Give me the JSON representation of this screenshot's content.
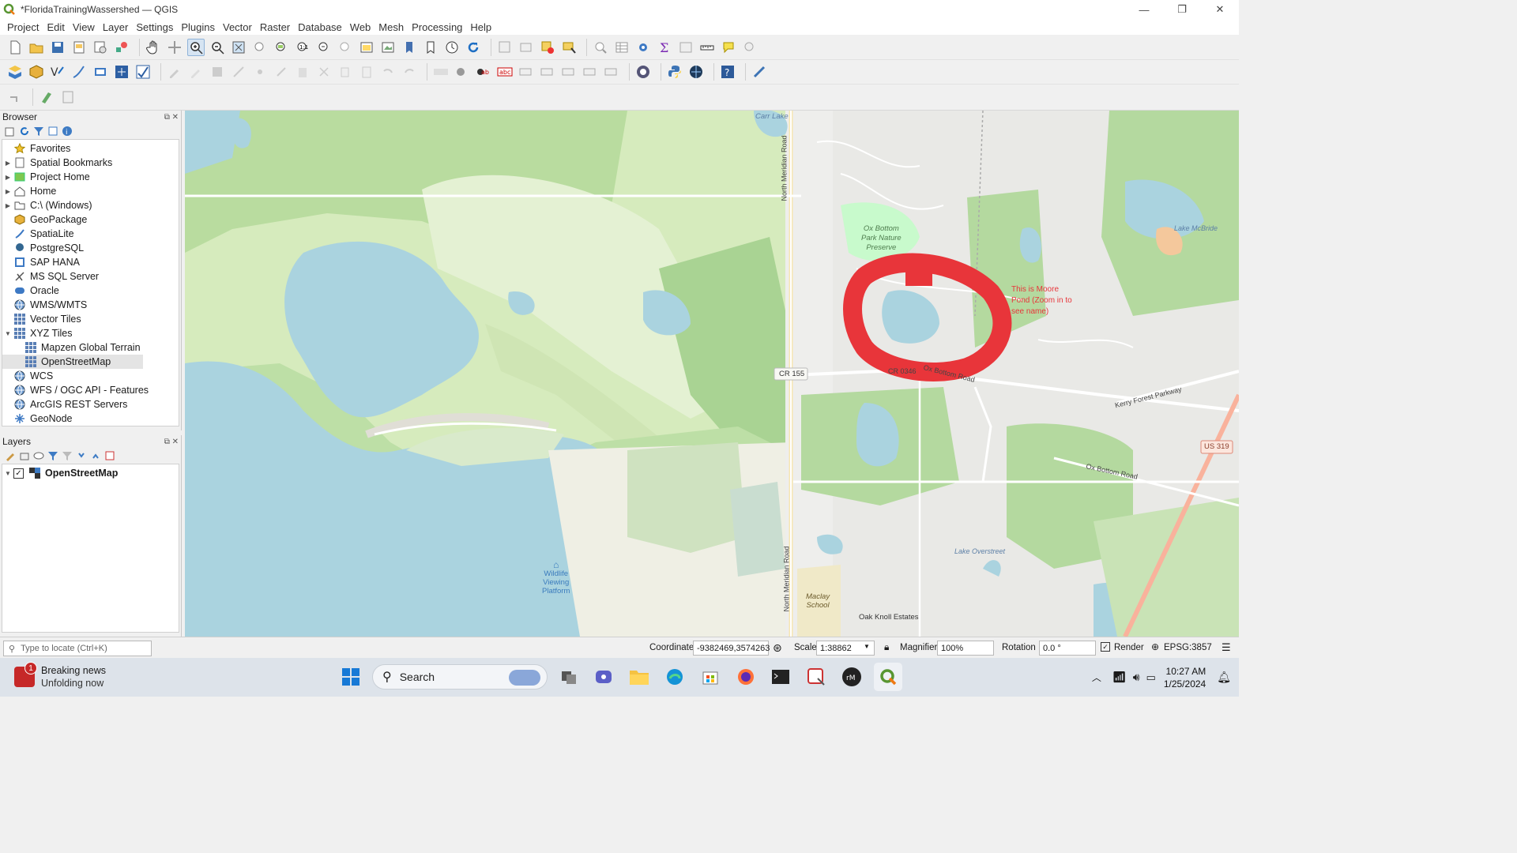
{
  "window": {
    "title": "*FloridaTrainingWassershed — QGIS",
    "controls": {
      "minimize": "—",
      "maximize": "❐",
      "close": "✕"
    }
  },
  "menu": [
    "Project",
    "Edit",
    "View",
    "Layer",
    "Settings",
    "Plugins",
    "Vector",
    "Raster",
    "Database",
    "Web",
    "Mesh",
    "Processing",
    "Help"
  ],
  "browser": {
    "title": "Browser",
    "items": [
      {
        "label": "Favorites",
        "icon": "star-icon",
        "expander": ""
      },
      {
        "label": "Spatial Bookmarks",
        "icon": "bookmark-icon",
        "expander": "▶"
      },
      {
        "label": "Project Home",
        "icon": "project-home-icon",
        "expander": "▶"
      },
      {
        "label": "Home",
        "icon": "home-icon",
        "expander": "▶"
      },
      {
        "label": "C:\\ (Windows)",
        "icon": "folder-icon",
        "expander": "▶"
      },
      {
        "label": "GeoPackage",
        "icon": "geopackage-icon",
        "expander": ""
      },
      {
        "label": "SpatiaLite",
        "icon": "spatialite-icon",
        "expander": ""
      },
      {
        "label": "PostgreSQL",
        "icon": "postgresql-icon",
        "expander": ""
      },
      {
        "label": "SAP HANA",
        "icon": "sap-hana-icon",
        "expander": ""
      },
      {
        "label": "MS SQL Server",
        "icon": "mssql-icon",
        "expander": ""
      },
      {
        "label": "Oracle",
        "icon": "oracle-icon",
        "expander": ""
      },
      {
        "label": "WMS/WMTS",
        "icon": "globe-icon",
        "expander": ""
      },
      {
        "label": "Vector Tiles",
        "icon": "grid-icon",
        "expander": ""
      },
      {
        "label": "XYZ Tiles",
        "icon": "grid-icon",
        "expander": "▼"
      },
      {
        "label": "Mapzen Global Terrain",
        "icon": "grid-icon",
        "expander": "",
        "indent": true
      },
      {
        "label": "OpenStreetMap",
        "icon": "grid-icon",
        "expander": "",
        "indent": true,
        "selected": true
      },
      {
        "label": "WCS",
        "icon": "globe-icon",
        "expander": ""
      },
      {
        "label": "WFS / OGC API - Features",
        "icon": "globe-icon",
        "expander": ""
      },
      {
        "label": "ArcGIS REST Servers",
        "icon": "globe-icon",
        "expander": ""
      },
      {
        "label": "GeoNode",
        "icon": "geonode-icon",
        "expander": ""
      }
    ]
  },
  "layers": {
    "title": "Layers",
    "items": [
      {
        "label": "OpenStreetMap",
        "checked": "✓",
        "expander": "▼"
      }
    ]
  },
  "map": {
    "labels": {
      "carr_lake": "Carr Lake",
      "north_meridian_road": "North Meridian Road",
      "ox_bottom_park_1": "Ox Bottom",
      "ox_bottom_park_2": "Park Nature",
      "ox_bottom_park_3": "Preserve",
      "lake_mcbride": "Lake McBride",
      "cr155": "CR 155",
      "cr0346": "CR 0346",
      "ox_bottom_road": "Ox Bottom Road",
      "kerry_forest": "Kerry Forest Parkway",
      "us319": "US 319",
      "ox_bottom_road_2": "Ox Bottom Road",
      "lake_overstreet": "Lake Overstreet",
      "maclay_school_1": "Maclay",
      "maclay_school_2": "School",
      "oak_knoll": "Oak Knoll Estates",
      "wildlife_1": "Wildlife",
      "wildlife_2": "Viewing",
      "wildlife_3": "Platform",
      "north_meridian_road_2": "North Meridian Road"
    },
    "annotation": {
      "line1": "This is Moore",
      "line2": "Pond (Zoom in to",
      "line3": "see name)",
      "color": "#e8353a"
    }
  },
  "status": {
    "locator_placeholder": "Type to locate (Ctrl+K)",
    "coordinate_label": "Coordinate",
    "coordinate_value": "-9382469,3574263",
    "scale_label": "Scale",
    "scale_value": "1:38862",
    "magnifier_label": "Magnifier",
    "magnifier_value": "100%",
    "rotation_label": "Rotation",
    "rotation_value": "0.0 °",
    "render_label": "Render",
    "crs": "EPSG:3857"
  },
  "taskbar": {
    "news_title": "Breaking news",
    "news_sub": "Unfolding now",
    "news_badge": "1",
    "search_label": "Search",
    "time": "10:27 AM",
    "date": "1/25/2024"
  },
  "colors": {
    "water": "#aad3df",
    "forest": "#add19e",
    "wood": "#c8e3b3",
    "park": "#c8facc",
    "land": "#f2efe9",
    "road": "#ffffff",
    "major_road": "#f9b29c"
  }
}
